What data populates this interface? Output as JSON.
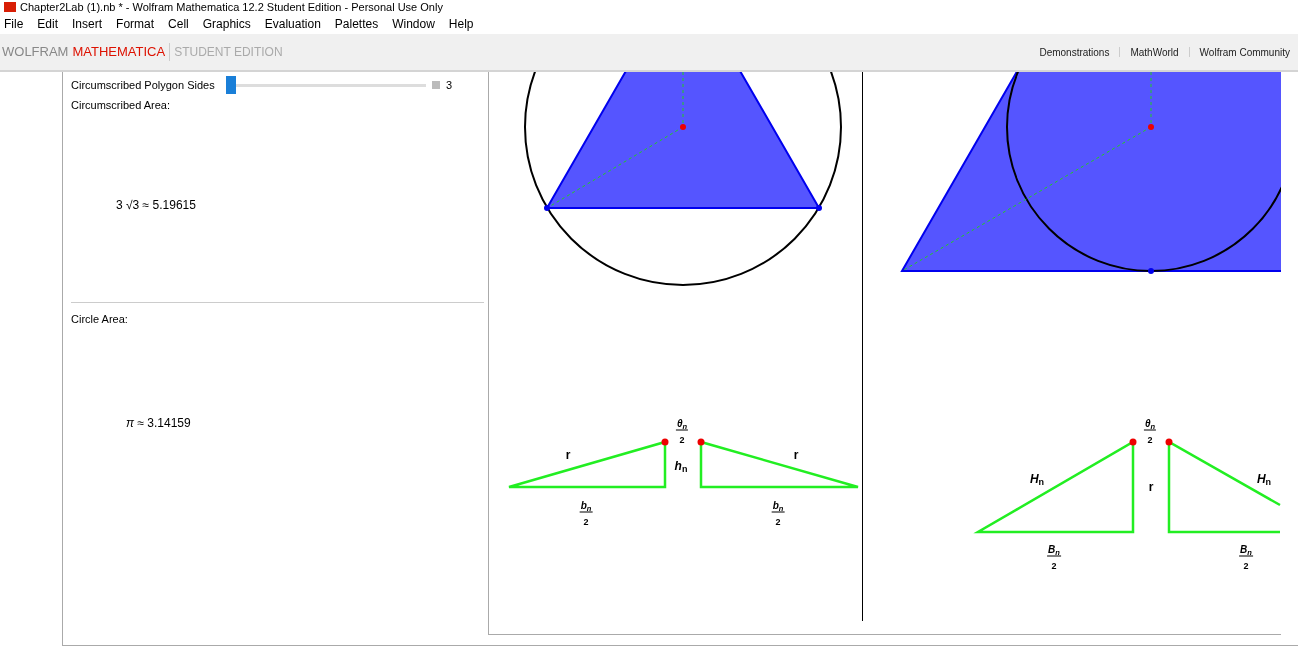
{
  "window": {
    "title": "Chapter2Lab (1).nb * - Wolfram Mathematica 12.2 Student Edition - Personal Use Only"
  },
  "menu": [
    "File",
    "Edit",
    "Insert",
    "Format",
    "Cell",
    "Graphics",
    "Evaluation",
    "Palettes",
    "Window",
    "Help"
  ],
  "brand": {
    "company": "WOLFRAM",
    "product": "MATHEMATICA",
    "edition": "STUDENT EDITION"
  },
  "links": [
    "Demonstrations",
    "MathWorld",
    "Wolfram Community"
  ],
  "slider": {
    "label": "Circumscribed Polygon Sides",
    "level": 0,
    "reading": "3"
  },
  "sections": [
    {
      "label": "Circumscribed Area:",
      "result": "3 √3 ≈ 5.19615"
    },
    {
      "label": "Circle Area:",
      "result": "*π* ≈ 3.14159"
    }
  ],
  "diagrams": [
    {
      "labels": [
        {
          "kind": "fraction",
          "numerator": "θ$_{n}$",
          "denominator": "2"
        },
        {
          "kind": "symbol",
          "text": "r"
        },
        {
          "kind": "symbol",
          "text": "*h*$_{n}$"
        },
        {
          "kind": "symbol",
          "text": "r"
        },
        {
          "kind": "fraction",
          "numerator": "b$_{n}$",
          "denominator": "2"
        },
        {
          "kind": "fraction",
          "numerator": "b$_{n}$",
          "denominator": "2"
        }
      ]
    },
    {
      "labels": [
        {
          "kind": "fraction",
          "numerator": "θ$_{n}$",
          "denominator": "2"
        },
        {
          "kind": "symbol",
          "text": "*H*$_{n}$"
        },
        {
          "kind": "symbol",
          "text": "r"
        },
        {
          "kind": "symbol",
          "text": "*H*$_{n}$"
        },
        {
          "kind": "fraction",
          "numerator": "B$_{n}$",
          "denominator": "2"
        },
        {
          "kind": "fraction",
          "numerator": "B$_{n}$",
          "denominator": "2"
        }
      ]
    }
  ]
}
